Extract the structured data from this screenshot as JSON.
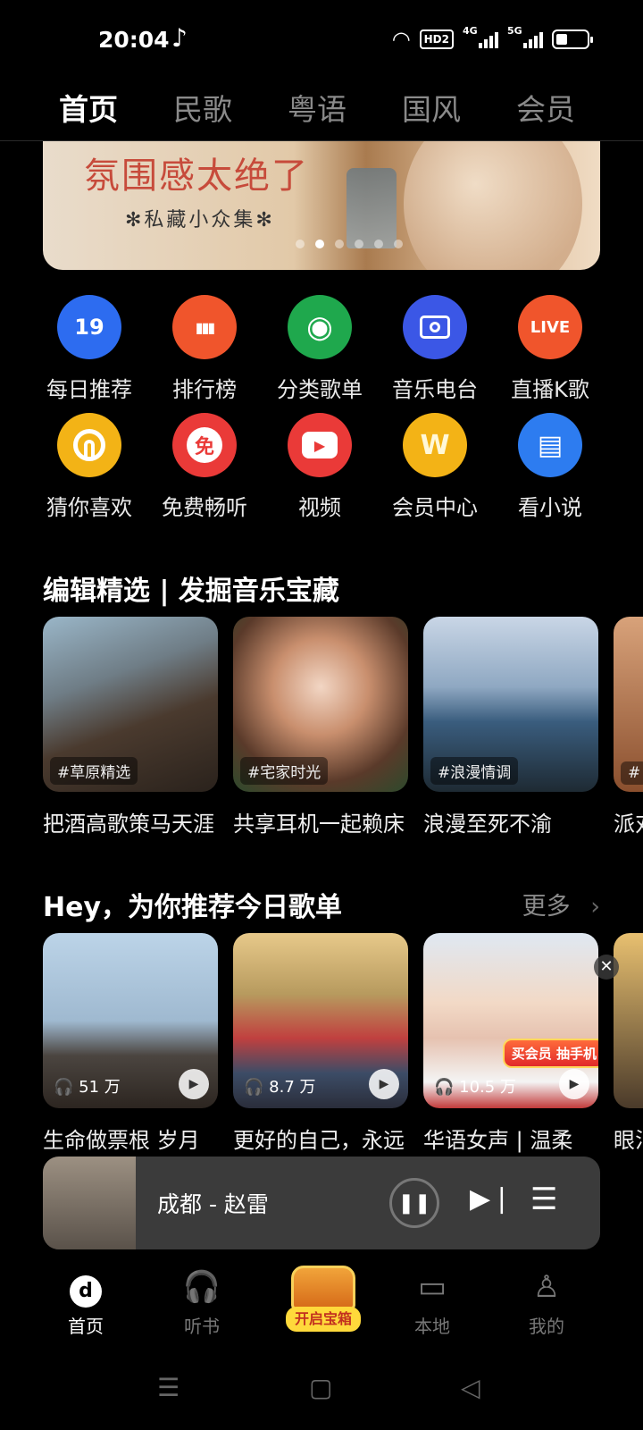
{
  "status": {
    "time": "20:04",
    "hd": "HD2",
    "net1": "4G",
    "net2": "5G"
  },
  "top_tabs": [
    {
      "label": "首页",
      "active": true
    },
    {
      "label": "民歌",
      "active": false
    },
    {
      "label": "粤语",
      "active": false
    },
    {
      "label": "国风",
      "active": false
    },
    {
      "label": "会员",
      "active": false
    }
  ],
  "banner": {
    "title": "氛围感太绝了",
    "subtitle": "✻私藏小众集✻",
    "page_count": 6,
    "current_page": 2
  },
  "grid": [
    {
      "label": "每日推荐",
      "icon": "calendar-19-icon",
      "glyph": "19",
      "color": "#2d6cf0"
    },
    {
      "label": "排行榜",
      "icon": "bar-chart-icon",
      "glyph": "▮▮▮",
      "color": "#f0552c"
    },
    {
      "label": "分类歌单",
      "icon": "disc-icon",
      "glyph": "◉",
      "color": "#1fa84d"
    },
    {
      "label": "音乐电台",
      "icon": "radio-icon",
      "glyph": "📻",
      "color": "#3b57e6"
    },
    {
      "label": "直播K歌",
      "icon": "live-icon",
      "glyph": "LIVE",
      "color": "#f0552c"
    },
    {
      "label": "猜你喜欢",
      "icon": "rainbow-icon",
      "glyph": "◒",
      "color": "#f3b316"
    },
    {
      "label": "免费畅听",
      "icon": "free-icon",
      "glyph": "免",
      "color": "#ea3a38"
    },
    {
      "label": "视频",
      "icon": "video-play-icon",
      "glyph": "▶",
      "color": "#ea3a38"
    },
    {
      "label": "会员中心",
      "icon": "vip-crown-icon",
      "glyph": "W",
      "color": "#f3b316"
    },
    {
      "label": "看小说",
      "icon": "book-icon",
      "glyph": "▤",
      "color": "#2d7cf0"
    }
  ],
  "editor_section": {
    "title": "编辑精选 | 发掘音乐宝藏",
    "cards": [
      {
        "tag": "#草原精选",
        "title": "把酒高歌策马天涯"
      },
      {
        "tag": "#宅家时光",
        "title": "共享耳机一起赖床"
      },
      {
        "tag": "#浪漫情调",
        "title": "浪漫至死不渝"
      },
      {
        "tag": "#",
        "title": "派对"
      }
    ]
  },
  "recommend_section": {
    "title": "Hey，为你推荐今日歌单",
    "more": "更多",
    "cards": [
      {
        "count": "51 万",
        "title": "生命做票根 岁月"
      },
      {
        "count": "8.7 万",
        "title": "更好的自己，永远"
      },
      {
        "count": "10.5 万",
        "title": "华语女声 | 温柔"
      },
      {
        "count": "",
        "title": "眼泪"
      }
    ],
    "ad_badge": "买会员 抽手机"
  },
  "player": {
    "song": "成都 - 赵雷"
  },
  "bottom_nav": [
    {
      "label": "首页",
      "active": true
    },
    {
      "label": "听书",
      "active": false
    },
    {
      "label": "开启宝箱",
      "active": false
    },
    {
      "label": "本地",
      "active": false
    },
    {
      "label": "我的",
      "active": false
    }
  ]
}
